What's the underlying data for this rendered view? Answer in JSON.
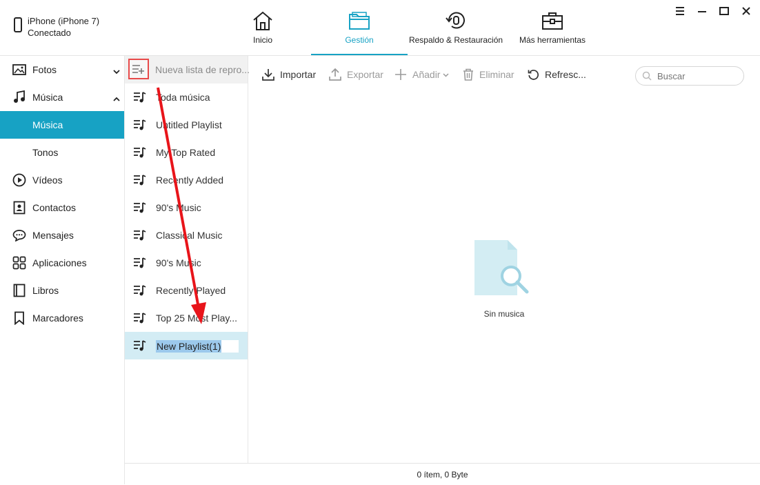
{
  "device": {
    "name": "iPhone (iPhone 7)",
    "status": "Conectado"
  },
  "nav": [
    {
      "label": "Inicio",
      "icon": "home-icon"
    },
    {
      "label": "Gestión",
      "icon": "folder-icon",
      "active": true
    },
    {
      "label": "Respaldo & Restauración",
      "icon": "backup-restore-icon"
    },
    {
      "label": "Más herramientas",
      "icon": "toolbox-icon"
    }
  ],
  "sidebar": {
    "items": [
      {
        "label": "Fotos",
        "icon": "photo-icon"
      },
      {
        "label": "Música",
        "icon": "music-note-icon"
      },
      {
        "label": "Música",
        "active": true
      },
      {
        "label": "Tonos"
      },
      {
        "label": "Vídeos",
        "icon": "play-circle-icon"
      },
      {
        "label": "Contactos",
        "icon": "contact-card-icon"
      },
      {
        "label": "Mensajes",
        "icon": "chat-bubble-icon"
      },
      {
        "label": "Aplicaciones",
        "icon": "apps-grid-icon"
      },
      {
        "label": "Libros",
        "icon": "book-icon"
      },
      {
        "label": "Marcadores",
        "icon": "bookmark-icon"
      }
    ]
  },
  "playlists": {
    "new_label": "Nueva lista de repro...",
    "items": [
      "Toda música",
      "Untitled Playlist",
      "My Top Rated",
      "Recently Added",
      "90's Music",
      "Classical Music",
      "90's Music",
      "Recently Played",
      "Top 25 Most Play..."
    ],
    "editing_value": "New Playlist(1)"
  },
  "toolbar": {
    "import": "Importar",
    "export": "Exportar",
    "add": "Añadir",
    "delete": "Eliminar",
    "refresh": "Refresc...",
    "search_placeholder": "Buscar"
  },
  "empty": {
    "caption": "Sin musica"
  },
  "status": {
    "text": "0 ítem, 0 Byte"
  },
  "colors": {
    "accent": "#17a2c4",
    "annotation": "#e8141a"
  }
}
